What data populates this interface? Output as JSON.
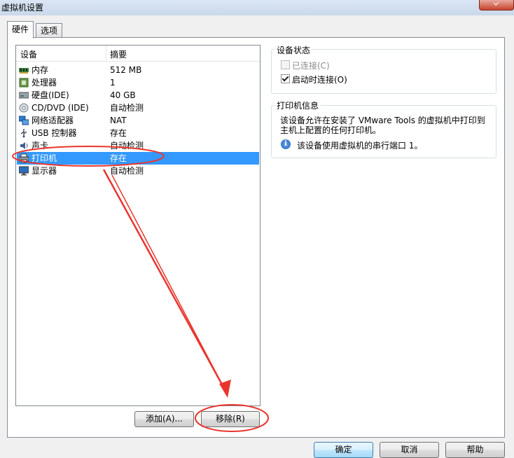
{
  "window": {
    "title": "虚拟机设置"
  },
  "tabs": [
    {
      "label": "硬件",
      "active": true
    },
    {
      "label": "选项",
      "active": false
    }
  ],
  "device_list": {
    "headers": {
      "device": "设备",
      "summary": "摘要"
    },
    "rows": [
      {
        "name": "内存",
        "summary": "512 MB",
        "icon": "memory-icon"
      },
      {
        "name": "处理器",
        "summary": "1",
        "icon": "processor-icon"
      },
      {
        "name": "硬盘(IDE)",
        "summary": "40 GB",
        "icon": "harddisk-icon"
      },
      {
        "name": "CD/DVD (IDE)",
        "summary": "自动检测",
        "icon": "cd-dvd-icon"
      },
      {
        "name": "网络适配器",
        "summary": "NAT",
        "icon": "network-adapter-icon"
      },
      {
        "name": "USB 控制器",
        "summary": "存在",
        "icon": "usb-icon"
      },
      {
        "name": "声卡",
        "summary": "自动检测",
        "icon": "sound-card-icon"
      },
      {
        "name": "打印机",
        "summary": "存在",
        "icon": "printer-icon",
        "selected": true
      },
      {
        "name": "显示器",
        "summary": "自动检测",
        "icon": "display-icon"
      }
    ]
  },
  "buttons": {
    "add": "添加(A)...",
    "remove": "移除(R)",
    "ok": "确定",
    "cancel": "取消",
    "help": "帮助"
  },
  "device_status": {
    "title": "设备状态",
    "connected": {
      "label": "已连接(C)",
      "checked": false,
      "disabled": true
    },
    "connect_at_power_on": {
      "label": "启动时连接(O)",
      "checked": true,
      "disabled": false
    }
  },
  "printer_info": {
    "title": "打印机信息",
    "line1": "该设备允许在安装了 VMware Tools 的虚拟机中打印到",
    "line2": "主机上配置的任何打印机。",
    "note": "该设备使用虚拟机的串行端口 1。"
  },
  "colors": {
    "selection": "#3399ff",
    "annotation": "#e8362f"
  }
}
